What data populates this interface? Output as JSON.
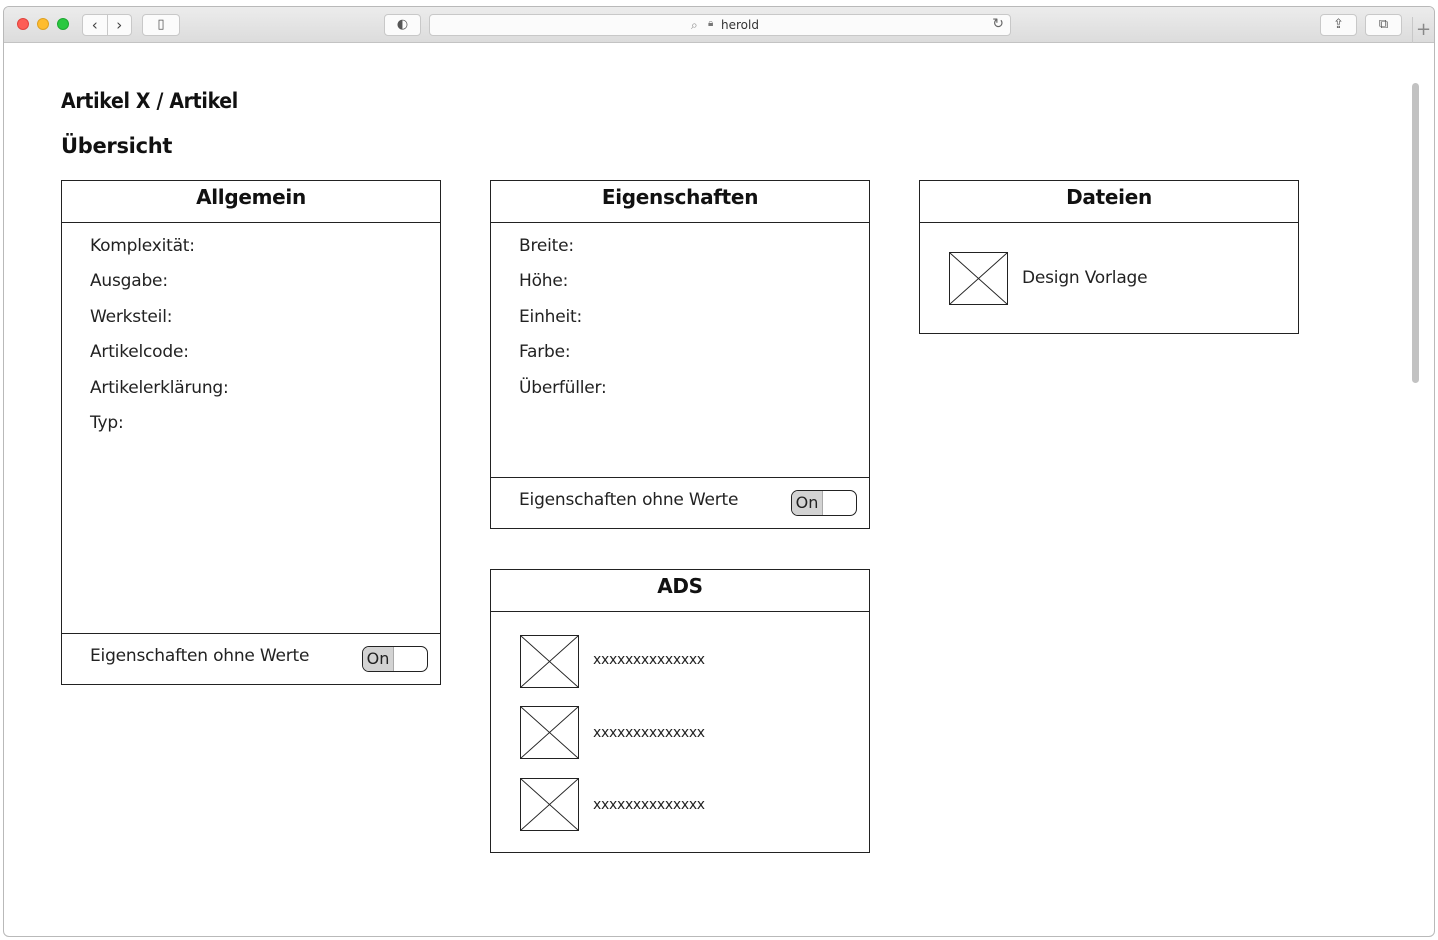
{
  "browser": {
    "url": "herold",
    "new_tab_label": "+"
  },
  "page": {
    "breadcrumb": "Artikel X / Artikel",
    "subtitle": "Übersicht"
  },
  "allgemein": {
    "title": "Allgemein",
    "fields": [
      "Komplexität:",
      "Ausgabe:",
      "Werksteil:",
      "Artikelcode:",
      "Artikelerklärung:",
      "Typ:"
    ],
    "footer_label": "Eigenschaften ohne Werte",
    "toggle_label": "On"
  },
  "eigenschaften": {
    "title": "Eigenschaften",
    "fields": [
      "Breite:",
      "Höhe:",
      "Einheit:",
      "Farbe:",
      "Überfüller:"
    ],
    "footer_label": "Eigenschaften ohne Werte",
    "toggle_label": "On"
  },
  "ads": {
    "title": "ADS",
    "items": [
      "xxxxxxxxxxxxxx",
      "xxxxxxxxxxxxxx",
      "xxxxxxxxxxxxxx"
    ]
  },
  "dateien": {
    "title": "Dateien",
    "files": [
      "Design Vorlage"
    ]
  }
}
